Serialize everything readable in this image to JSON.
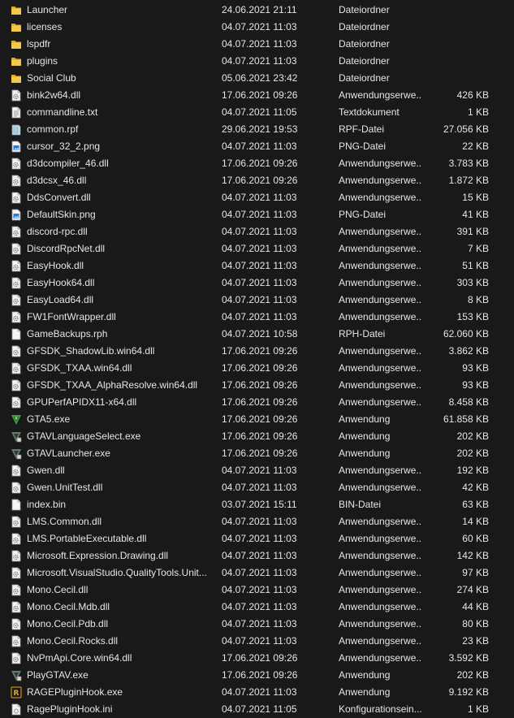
{
  "files": [
    {
      "name": "Launcher",
      "date": "24.06.2021 21:11",
      "type": "Dateiordner",
      "size": "",
      "icon": "folder"
    },
    {
      "name": "licenses",
      "date": "04.07.2021 11:03",
      "type": "Dateiordner",
      "size": "",
      "icon": "folder"
    },
    {
      "name": "lspdfr",
      "date": "04.07.2021 11:03",
      "type": "Dateiordner",
      "size": "",
      "icon": "folder"
    },
    {
      "name": "plugins",
      "date": "04.07.2021 11:03",
      "type": "Dateiordner",
      "size": "",
      "icon": "folder"
    },
    {
      "name": "Social Club",
      "date": "05.06.2021 23:42",
      "type": "Dateiordner",
      "size": "",
      "icon": "folder"
    },
    {
      "name": "bink2w64.dll",
      "date": "17.06.2021 09:26",
      "type": "Anwendungserwe...",
      "size": "426 KB",
      "icon": "dll"
    },
    {
      "name": "commandline.txt",
      "date": "04.07.2021 11:05",
      "type": "Textdokument",
      "size": "1 KB",
      "icon": "text"
    },
    {
      "name": "common.rpf",
      "date": "29.06.2021 19:53",
      "type": "RPF-Datei",
      "size": "27.056 KB",
      "icon": "rpf"
    },
    {
      "name": "cursor_32_2.png",
      "date": "04.07.2021 11:03",
      "type": "PNG-Datei",
      "size": "22 KB",
      "icon": "png"
    },
    {
      "name": "d3dcompiler_46.dll",
      "date": "17.06.2021 09:26",
      "type": "Anwendungserwe...",
      "size": "3.783 KB",
      "icon": "dll"
    },
    {
      "name": "d3dcsx_46.dll",
      "date": "17.06.2021 09:26",
      "type": "Anwendungserwe...",
      "size": "1.872 KB",
      "icon": "dll"
    },
    {
      "name": "DdsConvert.dll",
      "date": "04.07.2021 11:03",
      "type": "Anwendungserwe...",
      "size": "15 KB",
      "icon": "dll"
    },
    {
      "name": "DefaultSkin.png",
      "date": "04.07.2021 11:03",
      "type": "PNG-Datei",
      "size": "41 KB",
      "icon": "png"
    },
    {
      "name": "discord-rpc.dll",
      "date": "04.07.2021 11:03",
      "type": "Anwendungserwe...",
      "size": "391 KB",
      "icon": "dll"
    },
    {
      "name": "DiscordRpcNet.dll",
      "date": "04.07.2021 11:03",
      "type": "Anwendungserwe...",
      "size": "7 KB",
      "icon": "dll"
    },
    {
      "name": "EasyHook.dll",
      "date": "04.07.2021 11:03",
      "type": "Anwendungserwe...",
      "size": "51 KB",
      "icon": "dll"
    },
    {
      "name": "EasyHook64.dll",
      "date": "04.07.2021 11:03",
      "type": "Anwendungserwe...",
      "size": "303 KB",
      "icon": "dll"
    },
    {
      "name": "EasyLoad64.dll",
      "date": "04.07.2021 11:03",
      "type": "Anwendungserwe...",
      "size": "8 KB",
      "icon": "dll"
    },
    {
      "name": "FW1FontWrapper.dll",
      "date": "04.07.2021 11:03",
      "type": "Anwendungserwe...",
      "size": "153 KB",
      "icon": "dll"
    },
    {
      "name": "GameBackups.rph",
      "date": "04.07.2021 10:58",
      "type": "RPH-Datei",
      "size": "62.060 KB",
      "icon": "blank"
    },
    {
      "name": "GFSDK_ShadowLib.win64.dll",
      "date": "17.06.2021 09:26",
      "type": "Anwendungserwe...",
      "size": "3.862 KB",
      "icon": "dll"
    },
    {
      "name": "GFSDK_TXAA.win64.dll",
      "date": "17.06.2021 09:26",
      "type": "Anwendungserwe...",
      "size": "93 KB",
      "icon": "dll"
    },
    {
      "name": "GFSDK_TXAA_AlphaResolve.win64.dll",
      "date": "17.06.2021 09:26",
      "type": "Anwendungserwe...",
      "size": "93 KB",
      "icon": "dll"
    },
    {
      "name": "GPUPerfAPIDX11-x64.dll",
      "date": "17.06.2021 09:26",
      "type": "Anwendungserwe...",
      "size": "8.458 KB",
      "icon": "dll"
    },
    {
      "name": "GTA5.exe",
      "date": "17.06.2021 09:26",
      "type": "Anwendung",
      "size": "61.858 KB",
      "icon": "gta"
    },
    {
      "name": "GTAVLanguageSelect.exe",
      "date": "17.06.2021 09:26",
      "type": "Anwendung",
      "size": "202 KB",
      "icon": "gtagrey"
    },
    {
      "name": "GTAVLauncher.exe",
      "date": "17.06.2021 09:26",
      "type": "Anwendung",
      "size": "202 KB",
      "icon": "gtagrey"
    },
    {
      "name": "Gwen.dll",
      "date": "04.07.2021 11:03",
      "type": "Anwendungserwe...",
      "size": "192 KB",
      "icon": "dll"
    },
    {
      "name": "Gwen.UnitTest.dll",
      "date": "04.07.2021 11:03",
      "type": "Anwendungserwe...",
      "size": "42 KB",
      "icon": "dll"
    },
    {
      "name": "index.bin",
      "date": "03.07.2021 15:11",
      "type": "BIN-Datei",
      "size": "63 KB",
      "icon": "blank"
    },
    {
      "name": "LMS.Common.dll",
      "date": "04.07.2021 11:03",
      "type": "Anwendungserwe...",
      "size": "14 KB",
      "icon": "dll"
    },
    {
      "name": "LMS.PortableExecutable.dll",
      "date": "04.07.2021 11:03",
      "type": "Anwendungserwe...",
      "size": "60 KB",
      "icon": "dll"
    },
    {
      "name": "Microsoft.Expression.Drawing.dll",
      "date": "04.07.2021 11:03",
      "type": "Anwendungserwe...",
      "size": "142 KB",
      "icon": "dll"
    },
    {
      "name": "Microsoft.VisualStudio.QualityTools.Unit...",
      "date": "04.07.2021 11:03",
      "type": "Anwendungserwe...",
      "size": "97 KB",
      "icon": "dll"
    },
    {
      "name": "Mono.Cecil.dll",
      "date": "04.07.2021 11:03",
      "type": "Anwendungserwe...",
      "size": "274 KB",
      "icon": "dll"
    },
    {
      "name": "Mono.Cecil.Mdb.dll",
      "date": "04.07.2021 11:03",
      "type": "Anwendungserwe...",
      "size": "44 KB",
      "icon": "dll"
    },
    {
      "name": "Mono.Cecil.Pdb.dll",
      "date": "04.07.2021 11:03",
      "type": "Anwendungserwe...",
      "size": "80 KB",
      "icon": "dll"
    },
    {
      "name": "Mono.Cecil.Rocks.dll",
      "date": "04.07.2021 11:03",
      "type": "Anwendungserwe...",
      "size": "23 KB",
      "icon": "dll"
    },
    {
      "name": "NvPmApi.Core.win64.dll",
      "date": "17.06.2021 09:26",
      "type": "Anwendungserwe...",
      "size": "3.592 KB",
      "icon": "dll"
    },
    {
      "name": "PlayGTAV.exe",
      "date": "17.06.2021 09:26",
      "type": "Anwendung",
      "size": "202 KB",
      "icon": "gtagrey"
    },
    {
      "name": "RAGEPluginHook.exe",
      "date": "04.07.2021 11:03",
      "type": "Anwendung",
      "size": "9.192 KB",
      "icon": "rph"
    },
    {
      "name": "RagePluginHook.ini",
      "date": "04.07.2021 11:05",
      "type": "Konfigurationsein...",
      "size": "1 KB",
      "icon": "ini"
    }
  ],
  "icon_names": {
    "folder": "folder-icon",
    "dll": "dll-file-icon",
    "text": "text-file-icon",
    "rpf": "rpf-file-icon",
    "png": "png-file-icon",
    "blank": "blank-file-icon",
    "gta": "gta-v-icon",
    "gtagrey": "gta-v-launcher-icon",
    "rph": "rage-plugin-hook-icon",
    "ini": "ini-file-icon"
  },
  "colors": {
    "background": "#191919",
    "text": "#e6e6e6",
    "folder": "#f3c94a",
    "folder_dark": "#d9a92a",
    "gta_green": "#3f9a3b",
    "rph_orange": "#e8a326",
    "png_blue": "#2a7ad6"
  }
}
